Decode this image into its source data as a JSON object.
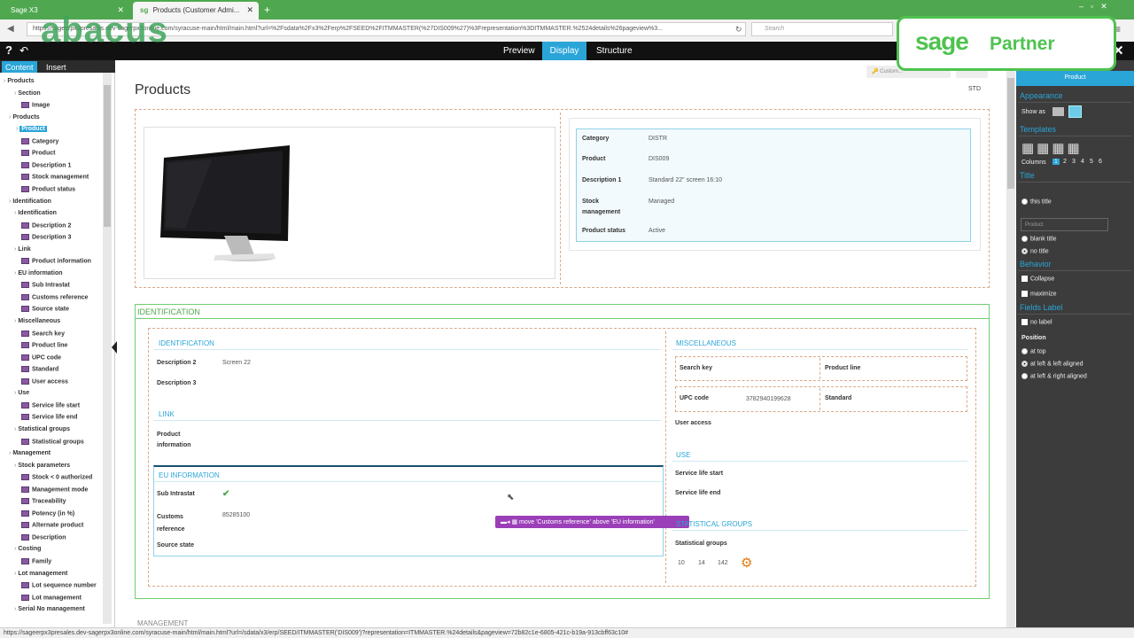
{
  "browser": {
    "tabs": [
      {
        "label": "Sage X3"
      },
      {
        "label": "Products (Customer Admi..."
      }
    ],
    "url": "https://sageerpx3presales.dev-sagerpx3online.com/syracuse-main/html/main.html?url=%2Fsdata%2Fx3%2Ferp%2FSEED%2FITMMASTER(%27DIS009%27)%3Frepresentation%3DITMMASTER.%2524details%26pageview%3...",
    "search_placeholder": "Search"
  },
  "watermark": {
    "logo": "abacus"
  },
  "partner_badge": {
    "brand": "sage",
    "label": "Partner"
  },
  "modes": [
    "Preview",
    "Display",
    "Structure"
  ],
  "active_mode": "Display",
  "left_tabs": [
    "Content",
    "Insert"
  ],
  "tree": [
    {
      "label": "Products",
      "kind": "root"
    },
    {
      "label": "Section",
      "kind": "sec"
    },
    {
      "label": "Image",
      "kind": "leaf"
    },
    {
      "label": "Products",
      "kind": "grn"
    },
    {
      "label": "Product",
      "kind": "sel"
    },
    {
      "label": "Category",
      "kind": "leaf"
    },
    {
      "label": "Product",
      "kind": "leaf"
    },
    {
      "label": "Description 1",
      "kind": "leaf"
    },
    {
      "label": "Stock management",
      "kind": "leaf"
    },
    {
      "label": "Product status",
      "kind": "leaf"
    },
    {
      "label": "Identification",
      "kind": "grn"
    },
    {
      "label": "Identification",
      "kind": "sec"
    },
    {
      "label": "Description 2",
      "kind": "leaf"
    },
    {
      "label": "Description 3",
      "kind": "leaf"
    },
    {
      "label": "Link",
      "kind": "sec"
    },
    {
      "label": "Product information",
      "kind": "leaf"
    },
    {
      "label": "EU information",
      "kind": "sec"
    },
    {
      "label": "Sub Intrastat",
      "kind": "leaf"
    },
    {
      "label": "Customs reference",
      "kind": "leaf"
    },
    {
      "label": "Source state",
      "kind": "leaf"
    },
    {
      "label": "Miscellaneous",
      "kind": "sec"
    },
    {
      "label": "Search key",
      "kind": "leaf"
    },
    {
      "label": "Product line",
      "kind": "leaf"
    },
    {
      "label": "UPC code",
      "kind": "leaf"
    },
    {
      "label": "Standard",
      "kind": "leaf"
    },
    {
      "label": "User access",
      "kind": "leaf"
    },
    {
      "label": "Use",
      "kind": "sec"
    },
    {
      "label": "Service life start",
      "kind": "leaf"
    },
    {
      "label": "Service life end",
      "kind": "leaf"
    },
    {
      "label": "Statistical groups",
      "kind": "sec"
    },
    {
      "label": "Statistical groups",
      "kind": "leaf"
    },
    {
      "label": "Management",
      "kind": "grn"
    },
    {
      "label": "Stock parameters",
      "kind": "sec"
    },
    {
      "label": "Stock < 0 authorized",
      "kind": "leaf"
    },
    {
      "label": "Management mode",
      "kind": "leaf"
    },
    {
      "label": "Traceability",
      "kind": "leaf"
    },
    {
      "label": "Potency (in %)",
      "kind": "leaf"
    },
    {
      "label": "Alternate product",
      "kind": "leaf"
    },
    {
      "label": "Description",
      "kind": "leaf"
    },
    {
      "label": "Costing",
      "kind": "sec"
    },
    {
      "label": "Family",
      "kind": "leaf"
    },
    {
      "label": "Lot management",
      "kind": "sec"
    },
    {
      "label": "Lot sequence number",
      "kind": "leaf"
    },
    {
      "label": "Lot management",
      "kind": "leaf"
    },
    {
      "label": "Serial No management",
      "kind": "sec"
    }
  ],
  "page": {
    "title": "Products",
    "custom_btn": "Custom...",
    "std_label": "STD"
  },
  "product_card": {
    "fields": [
      {
        "label": "Category",
        "value": "DISTR"
      },
      {
        "label": "Product",
        "value": "DIS009"
      },
      {
        "label": "Description 1",
        "value": "Standard 22\" screen 16:10"
      },
      {
        "label": "Stock management",
        "value": "Managed"
      },
      {
        "label": "Product status",
        "value": "Active"
      }
    ]
  },
  "identification": {
    "title": "IDENTIFICATION",
    "sub_title": "IDENTIFICATION",
    "desc2_label": "Description 2",
    "desc2_value": "Screen 22",
    "desc3_label": "Description 3",
    "link_title": "LINK",
    "prodinfo_label": "Product information",
    "eu_title": "EU INFORMATION",
    "intrastat_label": "Sub Intrastat",
    "customs_label": "Customs reference",
    "customs_value": "85285100",
    "source_label": "Source state",
    "misc_title": "MISCELLANEOUS",
    "search_key_label": "Search key",
    "product_line_label": "Product line",
    "upc_label": "UPC code",
    "upc_value": "3782940199628",
    "standard_label": "Standard",
    "user_access_label": "User access",
    "use_title": "USE",
    "life_start_label": "Service life start",
    "life_end_label": "Service life end",
    "stat_title": "STATISTICAL GROUPS",
    "stat_label": "Statistical groups",
    "stat_values": [
      "10",
      "14",
      "142"
    ]
  },
  "management_heading": "MANAGEMENT",
  "tooltip": "move 'Customs reference' above 'EU information'",
  "right_panel": {
    "header": "Product",
    "appearance": "Appearance",
    "show_as": "Show as",
    "templates": "Templates",
    "columns_label": "Columns",
    "columns": [
      "1",
      "2",
      "3",
      "4",
      "5",
      "6"
    ],
    "title_head": "Title",
    "this_title": "this title",
    "title_placeholder": "Product",
    "blank_title": "blank title",
    "no_title": "no title",
    "behavior": "Behavior",
    "collapse": "Collapse",
    "maximize": "maximize",
    "fields_label": "Fields Label",
    "no_label": "no label",
    "position": "Position",
    "at_top": "at top",
    "left_left": "at left & left aligned",
    "left_right": "at left & right aligned"
  },
  "status_url": "https://sageerpx3presales.dev-sagerpx3online.com/syracuse-main/html/main.html?url=/sdata/x3/erp/SEED/ITMMASTER('DIS009')?representation=ITMMASTER.%24details&pageview=72b82c1e-6805-421c-b19a-913cbff63c10#"
}
